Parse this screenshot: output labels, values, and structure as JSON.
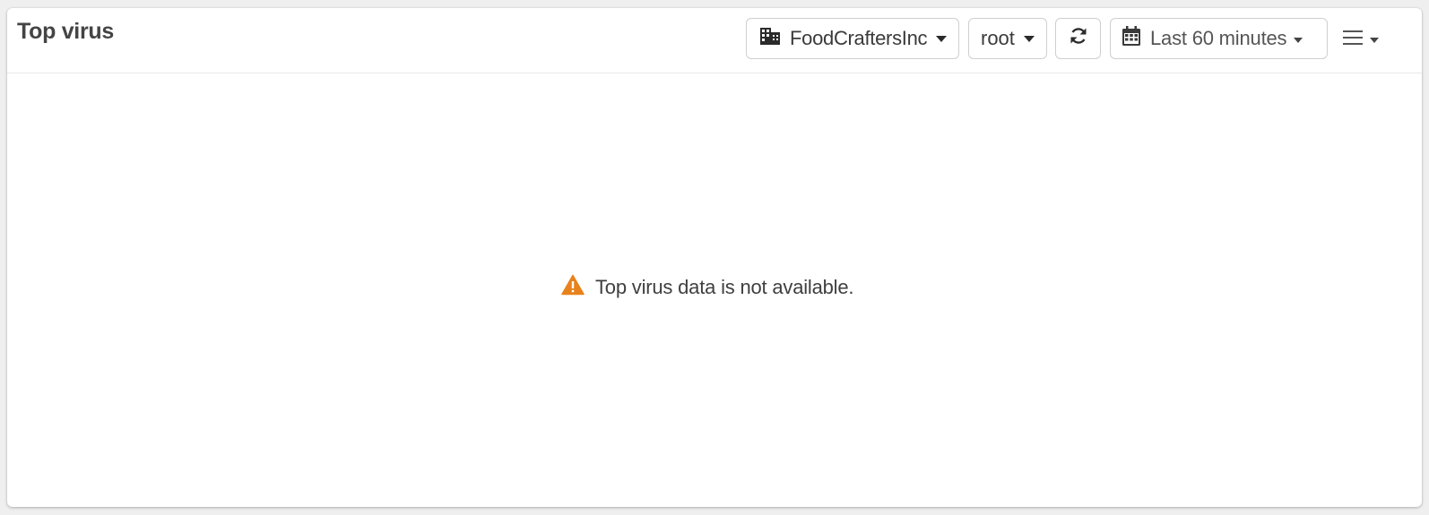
{
  "widget": {
    "title": "Top virus"
  },
  "toolbar": {
    "organization": "FoodCraftersInc",
    "user": "root",
    "time_range": "Last 60 minutes",
    "icons": {
      "organization": "building-icon",
      "refresh": "refresh-icon",
      "time_range": "calendar-icon",
      "menu": "hamburger-menu-icon"
    }
  },
  "body": {
    "empty_message": "Top virus data is not available.",
    "warning_color": "#e8821c"
  }
}
